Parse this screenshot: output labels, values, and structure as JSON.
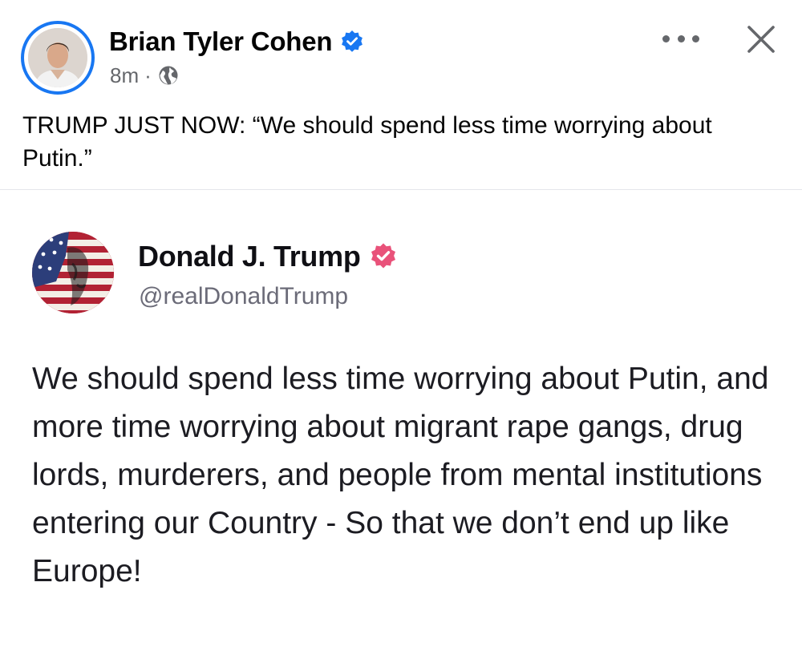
{
  "post": {
    "author": "Brian Tyler Cohen",
    "timestamp": "8m",
    "separator": "·",
    "caption": "TRUMP JUST NOW: “We should spend less time worrying about Putin.”"
  },
  "embed": {
    "author": "Donald J. Trump",
    "handle": "@realDonaldTrump",
    "body": "We should spend less time worrying about Putin, and more time worrying about migrant rape gangs, drug lords, murderers, and people from mental institutions entering our Country - So that we don’t end up like Europe!"
  },
  "icons": {
    "verified_fb": "verified-badge-icon",
    "globe": "globe-icon",
    "more": "more-options-icon",
    "close": "close-icon",
    "verified_ts": "verified-badge-icon"
  },
  "colors": {
    "fb_blue": "#1877f2",
    "meta_gray": "#65676b",
    "truth_verified": "#e9527a",
    "handle_gray": "#6b6b78"
  }
}
